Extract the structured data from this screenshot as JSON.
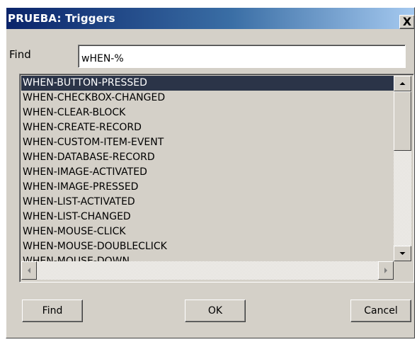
{
  "window": {
    "title": "PRUEBA: Triggers",
    "close_glyph": "X"
  },
  "find": {
    "label": "Find",
    "value": "wHEN-%"
  },
  "list": {
    "items": [
      "WHEN-BUTTON-PRESSED",
      "WHEN-CHECKBOX-CHANGED",
      "WHEN-CLEAR-BLOCK",
      "WHEN-CREATE-RECORD",
      "WHEN-CUSTOM-ITEM-EVENT",
      "WHEN-DATABASE-RECORD",
      "WHEN-IMAGE-ACTIVATED",
      "WHEN-IMAGE-PRESSED",
      "WHEN-LIST-ACTIVATED",
      "WHEN-LIST-CHANGED",
      "WHEN-MOUSE-CLICK",
      "WHEN-MOUSE-DOUBLECLICK",
      "WHEN-MOUSE-DOWN"
    ],
    "selected_index": 0
  },
  "buttons": {
    "find": "Find",
    "ok": "OK",
    "cancel": "Cancel"
  },
  "colors": {
    "face": "#d4d0c8",
    "title_start": "#0a246a",
    "title_end": "#a6caf0",
    "selection": "#2b3448"
  },
  "icons": {
    "up": "scroll-up-arrow-icon",
    "down": "scroll-down-arrow-icon",
    "left": "scroll-left-arrow-icon",
    "right": "scroll-right-arrow-icon",
    "close": "close-icon"
  }
}
